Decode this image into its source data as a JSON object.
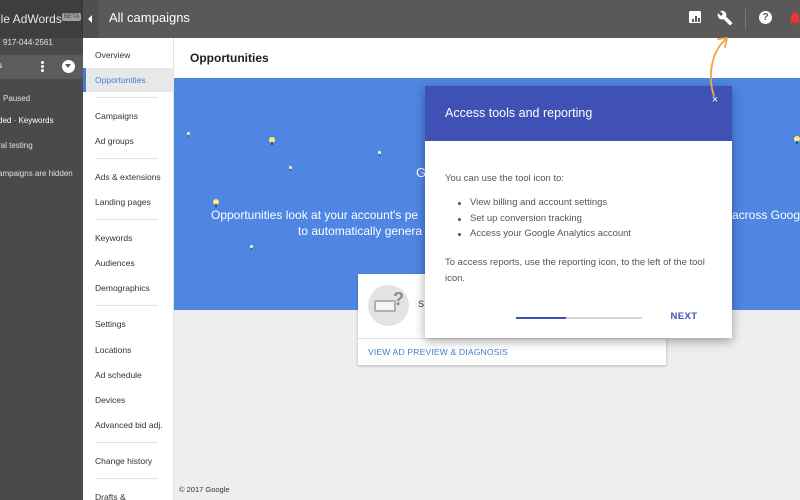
{
  "account": {
    "brand": "gle AdWords",
    "beta": "BETA",
    "phone": "917-044-2561",
    "selected_label": "s",
    "lines": [
      "Paused",
      "ded · Keywords",
      "ral testing",
      "ampaigns are hidden"
    ]
  },
  "topbar": {
    "title": "All campaigns"
  },
  "sidenav": {
    "items": [
      {
        "label": "Overview"
      },
      {
        "label": "Opportunities",
        "active": true
      },
      {
        "label": "Campaigns"
      },
      {
        "label": "Ad groups"
      },
      {
        "label": "Ads & extensions"
      },
      {
        "label": "Landing pages"
      },
      {
        "label": "Keywords"
      },
      {
        "label": "Audiences"
      },
      {
        "label": "Demographics"
      },
      {
        "label": "Settings"
      },
      {
        "label": "Locations"
      },
      {
        "label": "Ad schedule"
      },
      {
        "label": "Devices"
      },
      {
        "label": "Advanced bid adj."
      },
      {
        "label": "Change history"
      },
      {
        "label": "Drafts &"
      }
    ]
  },
  "main": {
    "page_title": "Opportunities",
    "banner": {
      "partial_g": "G",
      "line1": "Opportunities look at your account's pe",
      "line1_right": "across Goog",
      "line2": "to automatically genera"
    },
    "card": {
      "partial_text": "S",
      "link": "VIEW AD PREVIEW & DIAGNOSIS"
    },
    "footer": "© 2017 Google"
  },
  "modal": {
    "title": "Access tools and reporting",
    "close": "×",
    "intro": "You can use  the tool icon to:",
    "list": [
      "View billing and account settings",
      "Set up conversion tracking",
      "Access your Google Analytics account"
    ],
    "note": "To access reports, use the reporting icon, to the left of the tool icon.",
    "progress_fraction": 0.4,
    "next_label": "NEXT"
  },
  "colors": {
    "accent": "#3f51b5",
    "banner": "#4f86e3",
    "pointer": "#f0a44a"
  },
  "icons": [
    "report-icon",
    "wrench-icon",
    "help-icon",
    "bell-icon",
    "kebab-icon",
    "chevron-down-icon",
    "collapse-icon",
    "close-icon",
    "lightbulb-icon"
  ]
}
